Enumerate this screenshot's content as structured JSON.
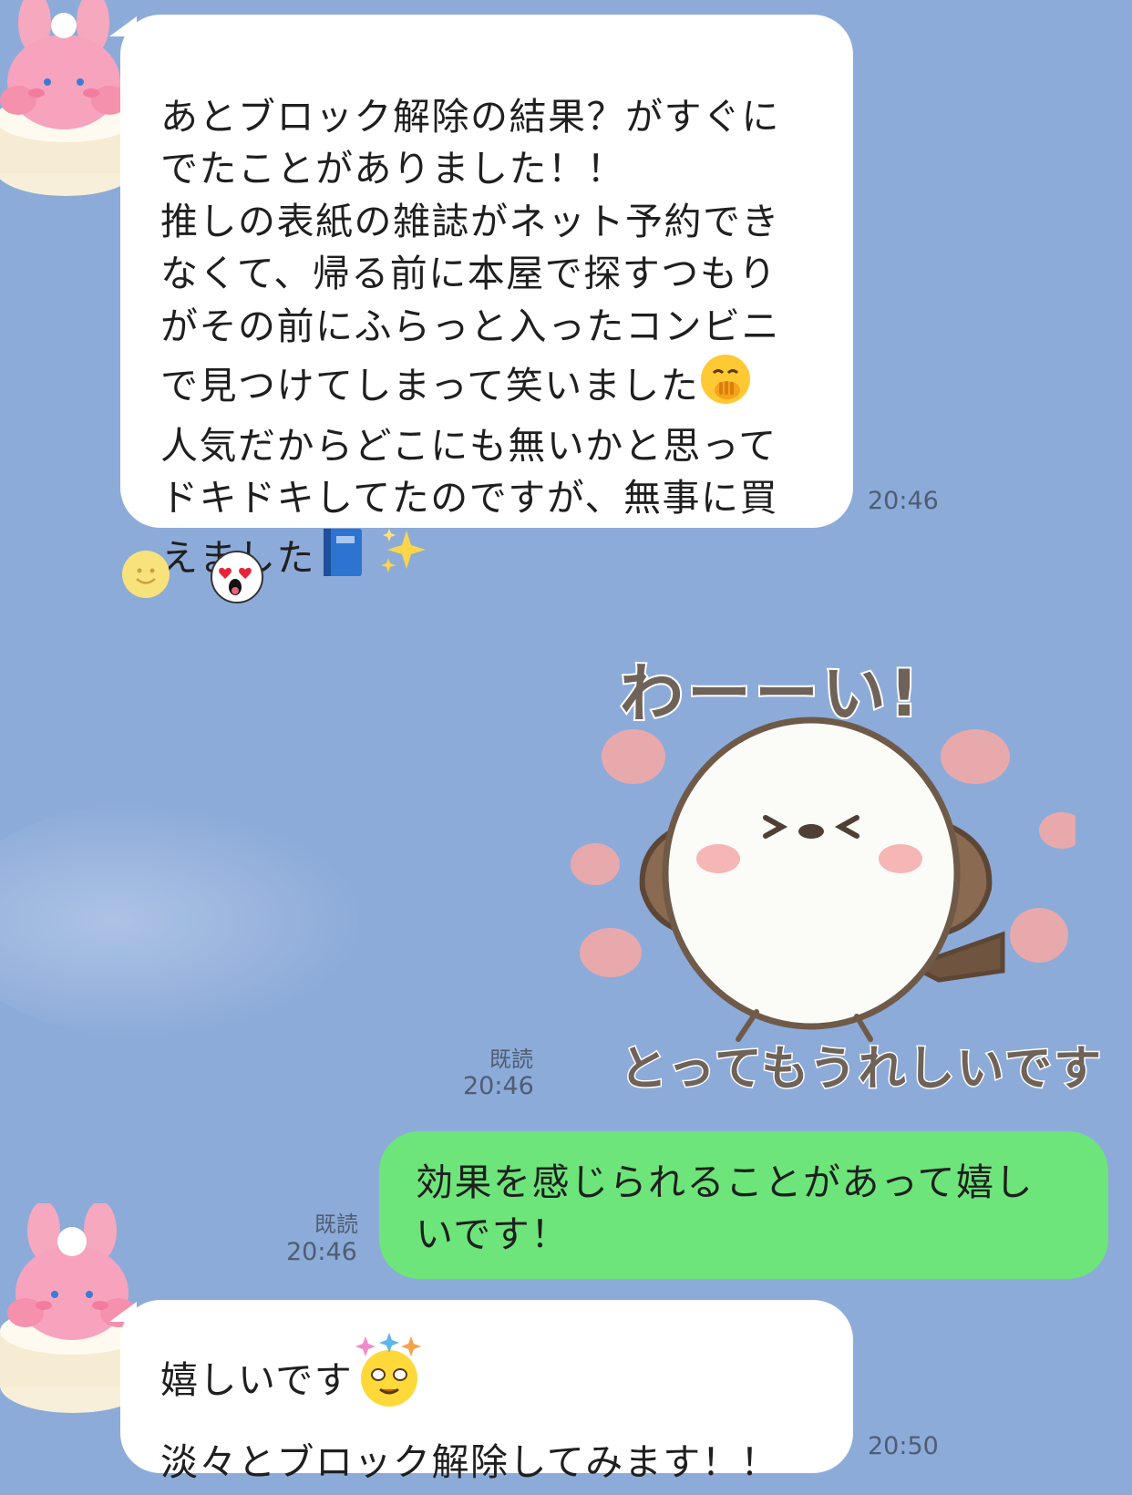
{
  "messages": {
    "msg1": {
      "text_lines": [
        "あとブロック解除の結果？がすぐに",
        "でたことがありました！！",
        "推しの表紙の雑誌がネット予約でき",
        "なくて、帰る前に本屋で探すつもり",
        "がその前にふらっと入ったコンビニ",
        "で見つけてしまって笑いました",
        "人気だからどこにも無いかと思って",
        "ドキドキしてたのですが、無事に買",
        "えました"
      ],
      "time": "20:46"
    },
    "sticker": {
      "text_top": "わーーい!",
      "text_bottom": "とってもうれしいです",
      "read": "既読",
      "time": "20:46"
    },
    "msg2": {
      "line1": "効果を感じられることがあって嬉し",
      "line2": "いです！",
      "read": "既読",
      "time": "20:46"
    },
    "msg3": {
      "line1": "嬉しいです",
      "line2": "淡々とブロック解除してみます！！",
      "time": "20:50"
    }
  },
  "colors": {
    "background": "#8dabd9",
    "incoming_bubble": "#ffffff",
    "outgoing_bubble": "#6de57a",
    "timestamp": "#4f5d73"
  },
  "icons": {
    "reaction_1": "smile-reaction-icon",
    "reaction_2": "heart-eyes-reaction-icon"
  }
}
